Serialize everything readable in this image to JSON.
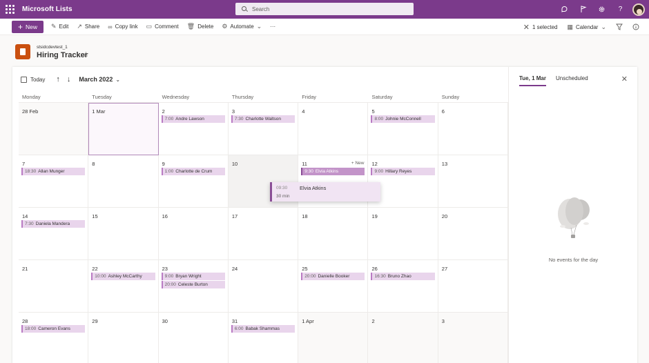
{
  "suitebar": {
    "app_name": "Microsoft Lists",
    "search_placeholder": "Search",
    "icons": [
      "waffle-icon",
      "feedback-icon",
      "flag-icon",
      "settings-icon",
      "help-icon",
      "avatar"
    ]
  },
  "commandbar": {
    "new_label": "New",
    "edit_label": "Edit",
    "share_label": "Share",
    "copylink_label": "Copy link",
    "comment_label": "Comment",
    "delete_label": "Delete",
    "automate_label": "Automate",
    "more_label": "···",
    "selected_label": "1 selected",
    "view_label": "Calendar"
  },
  "site": {
    "subtitle": "stsidcdevtest_1",
    "title": "Hiring Tracker"
  },
  "calendar": {
    "today_label": "Today",
    "month_label": "March 2022",
    "weekdays": [
      "Monday",
      "Tuesday",
      "Wednesday",
      "Thursday",
      "Friday",
      "Saturday",
      "Sunday"
    ],
    "weeks": [
      [
        {
          "day": "28 Feb",
          "state": "other",
          "events": []
        },
        {
          "day": "1 Mar",
          "state": "sel",
          "events": []
        },
        {
          "day": "2",
          "events": [
            {
              "time": "7:00",
              "name": "Andre Lawson"
            }
          ]
        },
        {
          "day": "3",
          "events": [
            {
              "time": "7:30",
              "name": "Charlotte Waltson"
            }
          ]
        },
        {
          "day": "4",
          "events": []
        },
        {
          "day": "5",
          "events": [
            {
              "time": "8:00",
              "name": "Johnie McConnell"
            }
          ]
        },
        {
          "day": "6",
          "events": []
        }
      ],
      [
        {
          "day": "7",
          "events": [
            {
              "time": "18:30",
              "name": "Allan Munger"
            }
          ]
        },
        {
          "day": "8",
          "events": []
        },
        {
          "day": "9",
          "events": [
            {
              "time": "1:00",
              "name": "Charlotte de Crum"
            }
          ]
        },
        {
          "day": "10",
          "state": "dim",
          "events": []
        },
        {
          "day": "11",
          "new_tag": "+ New",
          "events": [
            {
              "time": "9:30",
              "name": "Elvia Atkins",
              "highlight": true
            }
          ]
        },
        {
          "day": "12",
          "events": [
            {
              "time": "9:00",
              "name": "Hillary Reyes"
            }
          ]
        },
        {
          "day": "13",
          "events": []
        }
      ],
      [
        {
          "day": "14",
          "events": [
            {
              "time": "7:30",
              "name": "Daniela Mandera"
            }
          ]
        },
        {
          "day": "15",
          "events": []
        },
        {
          "day": "16",
          "events": []
        },
        {
          "day": "17",
          "events": []
        },
        {
          "day": "18",
          "events": []
        },
        {
          "day": "19",
          "events": []
        },
        {
          "day": "20",
          "events": []
        }
      ],
      [
        {
          "day": "21",
          "events": []
        },
        {
          "day": "22",
          "events": [
            {
              "time": "10:00",
              "name": "Ashley McCarthy"
            }
          ]
        },
        {
          "day": "23",
          "events": [
            {
              "time": "9:00",
              "name": "Bryan Wright"
            },
            {
              "time": "20:00",
              "name": "Celeste Burton"
            }
          ]
        },
        {
          "day": "24",
          "events": []
        },
        {
          "day": "25",
          "events": [
            {
              "time": "20:00",
              "name": "Danielle Booker"
            }
          ]
        },
        {
          "day": "26",
          "events": [
            {
              "time": "16:30",
              "name": "Bruno Zhao"
            }
          ]
        },
        {
          "day": "27",
          "events": []
        }
      ],
      [
        {
          "day": "28",
          "events": [
            {
              "time": "18:00",
              "name": "Cameron Evans"
            }
          ]
        },
        {
          "day": "29",
          "events": []
        },
        {
          "day": "30",
          "events": []
        },
        {
          "day": "31",
          "events": [
            {
              "time": "6:00",
              "name": "Babak Shammas"
            }
          ]
        },
        {
          "day": "1 Apr",
          "state": "other",
          "events": []
        },
        {
          "day": "2",
          "state": "other",
          "events": []
        },
        {
          "day": "3",
          "state": "other",
          "events": []
        }
      ]
    ],
    "drag_preview": {
      "time": "09:30",
      "name": "Elvia Atkins",
      "duration": "30 min"
    }
  },
  "sidepanel": {
    "tab_day": "Tue, 1 Mar",
    "tab_unscheduled": "Unscheduled",
    "empty_text": "No events for the day"
  }
}
